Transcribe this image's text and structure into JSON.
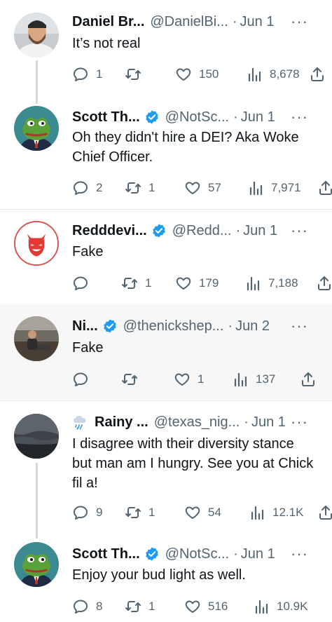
{
  "colors": {
    "text": "#0f1419",
    "secondary": "#536471",
    "verified": "#1d9bf0",
    "divider": "#e6e9ec"
  },
  "tweets": [
    {
      "name": "Daniel Br...",
      "handle": "@DanielBi...",
      "sep": "·",
      "date": "Jun 1",
      "more": "···",
      "text": "It’s not real",
      "replies": "1",
      "retweets": "",
      "likes": "150",
      "views": "8,678",
      "verified": false,
      "avatar": "bearded-man"
    },
    {
      "name": "Scott Th...",
      "handle": "@NotSc...",
      "sep": "·",
      "date": "Jun 1",
      "more": "···",
      "text": "Oh they didn't hire a DEI? Aka Woke Chief Officer.",
      "replies": "2",
      "retweets": "1",
      "likes": "57",
      "views": "7,971",
      "verified": true,
      "avatar": "pepe-frog"
    },
    {
      "name": "Redddevi...",
      "handle": "@Redd...",
      "sep": "·",
      "date": "Jun 1",
      "more": "···",
      "text": "Fake",
      "replies": "",
      "retweets": "1",
      "likes": "179",
      "views": "7,188",
      "verified": true,
      "avatar": "red-devil-logo"
    },
    {
      "name": "Ni...",
      "handle": "@thenickshep...",
      "sep": "·",
      "date": "Jun 2",
      "more": "···",
      "text": "Fake",
      "replies": "",
      "retweets": "",
      "likes": "1",
      "views": "137",
      "verified": true,
      "avatar": "man-on-couch"
    },
    {
      "name": "Rainy ...",
      "handle": "@texas_nig...",
      "sep": "·",
      "date": "Jun 1",
      "more": "···",
      "text": "I disagree with their diversity stance but man am I hungry. See you at Chick fil a!",
      "replies": "9",
      "retweets": "1",
      "likes": "54",
      "views": "12.1K",
      "verified": false,
      "emoji": "rain-cloud-icon",
      "avatar": "stormy-landscape"
    },
    {
      "name": "Scott Th...",
      "handle": "@NotSc...",
      "sep": "·",
      "date": "Jun 1",
      "more": "···",
      "text": "Enjoy your bud light as well.",
      "replies": "8",
      "retweets": "1",
      "likes": "516",
      "views": "10.9K",
      "verified": true,
      "avatar": "pepe-frog"
    }
  ]
}
